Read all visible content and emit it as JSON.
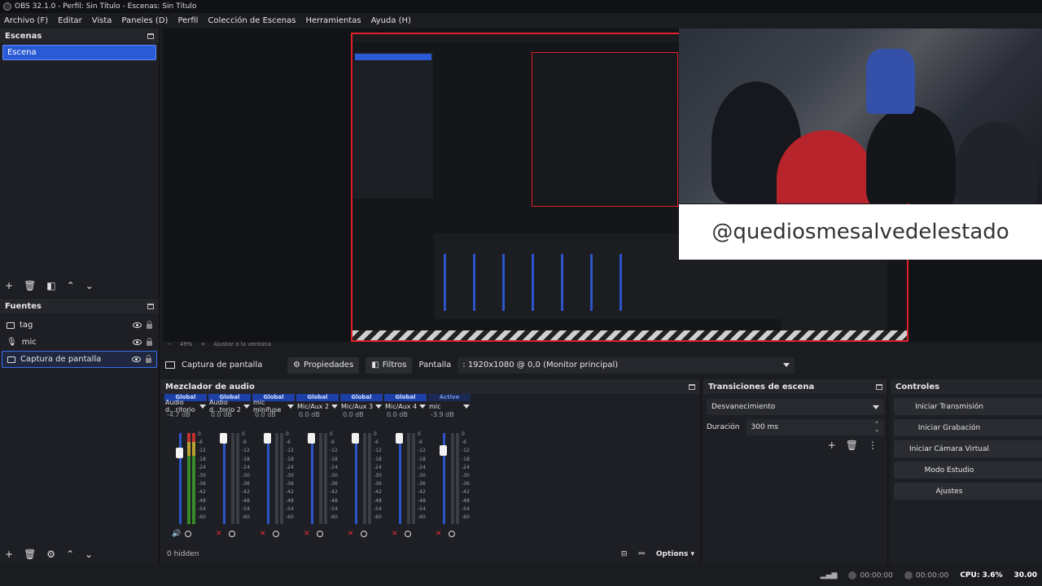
{
  "window": {
    "title": "OBS 32.1.0 - Perfil: Sin Título - Escenas: Sin Título"
  },
  "menu": [
    "Archivo (F)",
    "Editar",
    "Vista",
    "Paneles (D)",
    "Perfil",
    "Colección de Escenas",
    "Herramientas",
    "Ayuda (H)"
  ],
  "scenes": {
    "title": "Escenas",
    "items": [
      "Escena"
    ]
  },
  "sources": {
    "title": "Fuentes",
    "items": [
      {
        "name": "tag",
        "icon": "image-icon"
      },
      {
        "name": "mic",
        "icon": "microphone-icon"
      },
      {
        "name": "Captura de pantalla",
        "icon": "monitor-icon"
      }
    ]
  },
  "preview": {
    "overlay_text": "@quediosmesalvedelestado",
    "zoom": "49%",
    "fit": "Ajustar a la ventana"
  },
  "source_toolbar": {
    "source": "Captura de pantalla",
    "properties": "Propiedades",
    "filters": "Filtros",
    "display_label": "Pantalla",
    "display_value": ": 1920x1080 @ 0,0 (Monitor principal)"
  },
  "mixer": {
    "title": "Mezclador de audio",
    "channels": [
      {
        "tag": "Global",
        "name": "Audio d...ritorio",
        "db": "-4.7 dB",
        "level": 0.84
      },
      {
        "tag": "Global",
        "name": "Audio d...torio 2",
        "db": "0.0 dB",
        "level": 1.0
      },
      {
        "tag": "Global",
        "name": "mic minifuse",
        "db": "0.0 dB",
        "level": 1.0
      },
      {
        "tag": "Global",
        "name": "Mic/Aux 2",
        "db": "0.0 dB",
        "level": 1.0
      },
      {
        "tag": "Global",
        "name": "Mic/Aux 3",
        "db": "0.0 dB",
        "level": 1.0
      },
      {
        "tag": "Global",
        "name": "Mic/Aux 4",
        "db": "0.0 dB",
        "level": 1.0
      },
      {
        "tag": "Active",
        "name": "mic",
        "db": "-3.9 dB",
        "level": 0.86
      }
    ],
    "scale": [
      "0",
      "-6",
      "-12",
      "-18",
      "-24",
      "-30",
      "-36",
      "-42",
      "-48",
      "-54",
      "-60"
    ],
    "hidden": "0 hidden",
    "options": "Options"
  },
  "transitions": {
    "title": "Transiciones de escena",
    "selected": "Desvanecimiento",
    "duration_label": "Duración",
    "duration_value": "300 ms"
  },
  "controls": {
    "title": "Controles",
    "buttons": [
      "Iniciar Transmisión",
      "Iniciar Grabación",
      "Iniciar Cámara Virtual",
      "Modo Estudio",
      "Ajustes"
    ]
  },
  "status": {
    "stream_time": "00:00:00",
    "rec_time": "00:00:00",
    "cpu": "CPU: 3.6%",
    "fps": "30.00"
  },
  "colors": {
    "accent": "#2b5ad6",
    "preview_border": "#e0202a",
    "mute": "#e0303a"
  }
}
